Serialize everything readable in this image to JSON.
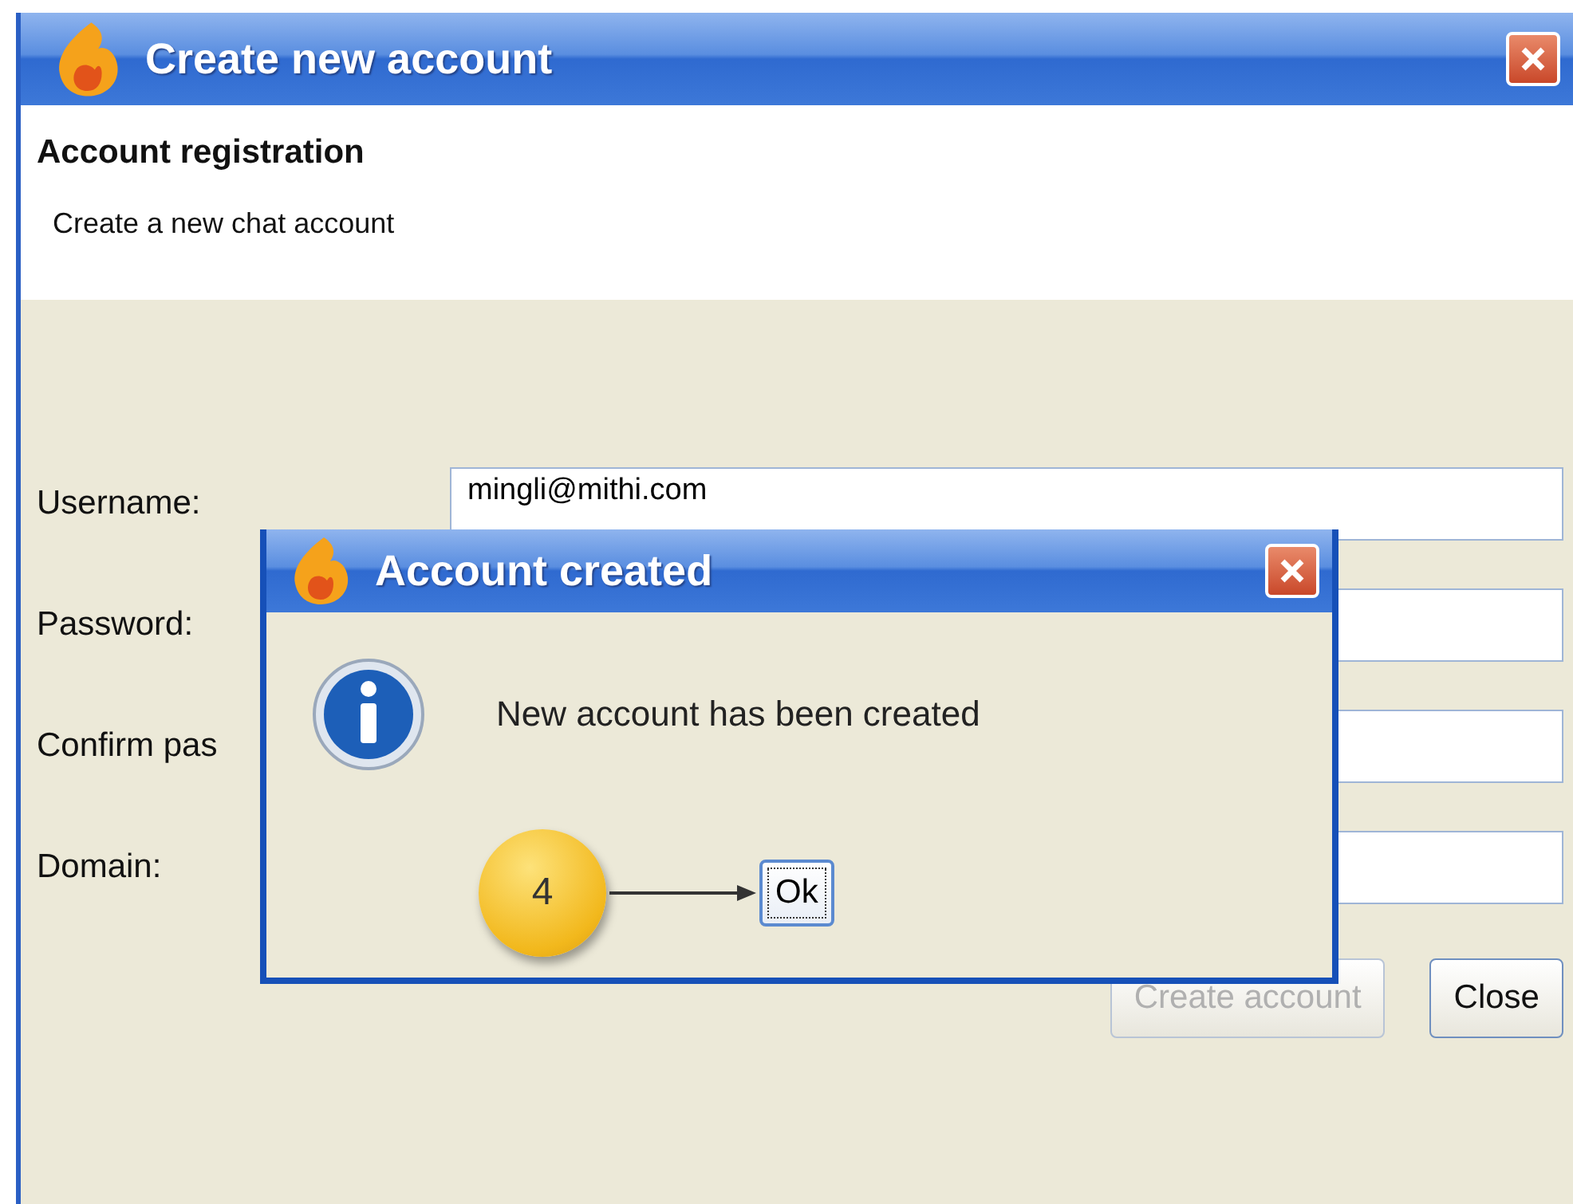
{
  "window": {
    "title": "Create new account"
  },
  "header": {
    "title": "Account registration",
    "subtitle": "Create a new chat account"
  },
  "fields": [
    {
      "label": "Username:",
      "value": "mingli@mithi.com"
    },
    {
      "label": "Password:"
    },
    {
      "label": "Confirm pas"
    },
    {
      "label": "Domain:"
    }
  ],
  "buttons": [
    {
      "label": "Create account",
      "disabled": true
    },
    {
      "label": "Close",
      "disabled": false
    }
  ],
  "dialog": {
    "title": "Account created",
    "message": "New account has been created",
    "button": "Ok",
    "step": "4"
  }
}
